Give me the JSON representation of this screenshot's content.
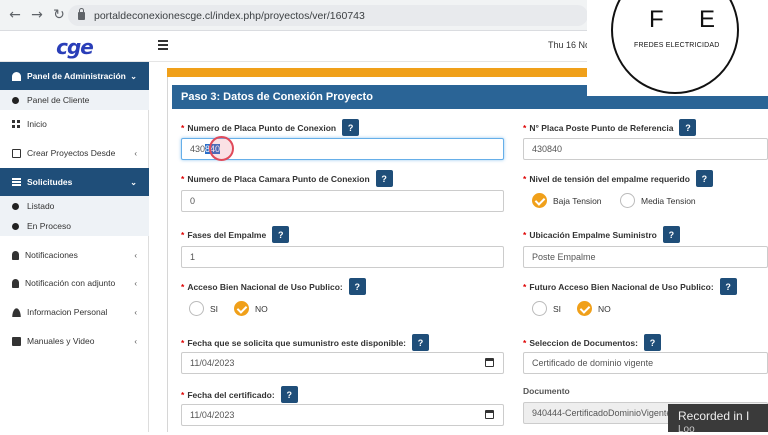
{
  "browser": {
    "back": "←",
    "forward": "→",
    "reload": "↻",
    "url": "portaldeconexionescge.cl/index.php/proyectos/ver/160743"
  },
  "header": {
    "logo": "cge",
    "date": "Thu 16 No"
  },
  "watermark": {
    "letter_f": "F",
    "letter_e": "E",
    "name": "FREDES ELECTRICIDAD"
  },
  "sidebar": {
    "items": [
      {
        "label": "Panel de Administración",
        "chevron": "⌄"
      },
      {
        "label": "Panel de Cliente"
      },
      {
        "label": "Inicio"
      },
      {
        "label": "Crear Proyectos Desde",
        "chevron": "‹"
      },
      {
        "label": "Solicitudes",
        "chevron": "⌄"
      },
      {
        "label": "Listado"
      },
      {
        "label": "En Proceso"
      },
      {
        "label": "Notificaciones",
        "chevron": "‹"
      },
      {
        "label": "Notificación con adjunto",
        "chevron": "‹"
      },
      {
        "label": "Informacion Personal",
        "chevron": "‹"
      },
      {
        "label": "Manuales y Video",
        "chevron": "‹"
      }
    ]
  },
  "form": {
    "title": "Paso 3: Datos de Conexión Proyecto",
    "required_mark": "*",
    "help": "?",
    "placa_conexion": {
      "label": "Numero de Placa Punto de Conexion",
      "value_pre": "430",
      "value_selected": "840"
    },
    "placa_poste": {
      "label": "N° Placa Poste Punto de Referencia",
      "value": "430840"
    },
    "placa_camara": {
      "label": "Numero de Placa Camara Punto de Conexion",
      "value": "0"
    },
    "nivel_tension": {
      "label": "Nivel de tensión del empalme requerido",
      "options": [
        "Baja Tension",
        "Media Tension"
      ],
      "selected": "Baja Tension"
    },
    "fases": {
      "label": "Fases del Empalme",
      "value": "1"
    },
    "ubicacion": {
      "label": "Ubicación Empalme Suministro",
      "value": "Poste Empalme"
    },
    "acceso_bien": {
      "label": "Acceso Bien Nacional de Uso Publico:",
      "options": [
        "SI",
        "NO"
      ],
      "selected": "NO"
    },
    "futuro_acceso": {
      "label": "Futuro Acceso Bien Nacional de Uso Publico:",
      "options": [
        "SI",
        "NO"
      ],
      "selected": "NO"
    },
    "fecha_solicita": {
      "label": "Fecha que se solicita que sumunistro este disponible:",
      "value": "11/04/2023"
    },
    "seleccion_docs": {
      "label": "Seleccion de Documentos:",
      "value": "Certificado de dominio vigente"
    },
    "fecha_certificado": {
      "label": "Fecha del certificado:",
      "value": "11/04/2023"
    },
    "documento": {
      "label": "Documento",
      "value": "940444-CertificadoDominioVigente.pdf"
    }
  },
  "overlay": {
    "recorded": "Recorded in I",
    "sub": "Loo"
  },
  "colors": {
    "sidebar_active": "#1f4e79",
    "panel_header": "#2a6496",
    "accent_orange": "#f0a01a",
    "logo_blue": "#2a3eb8"
  }
}
